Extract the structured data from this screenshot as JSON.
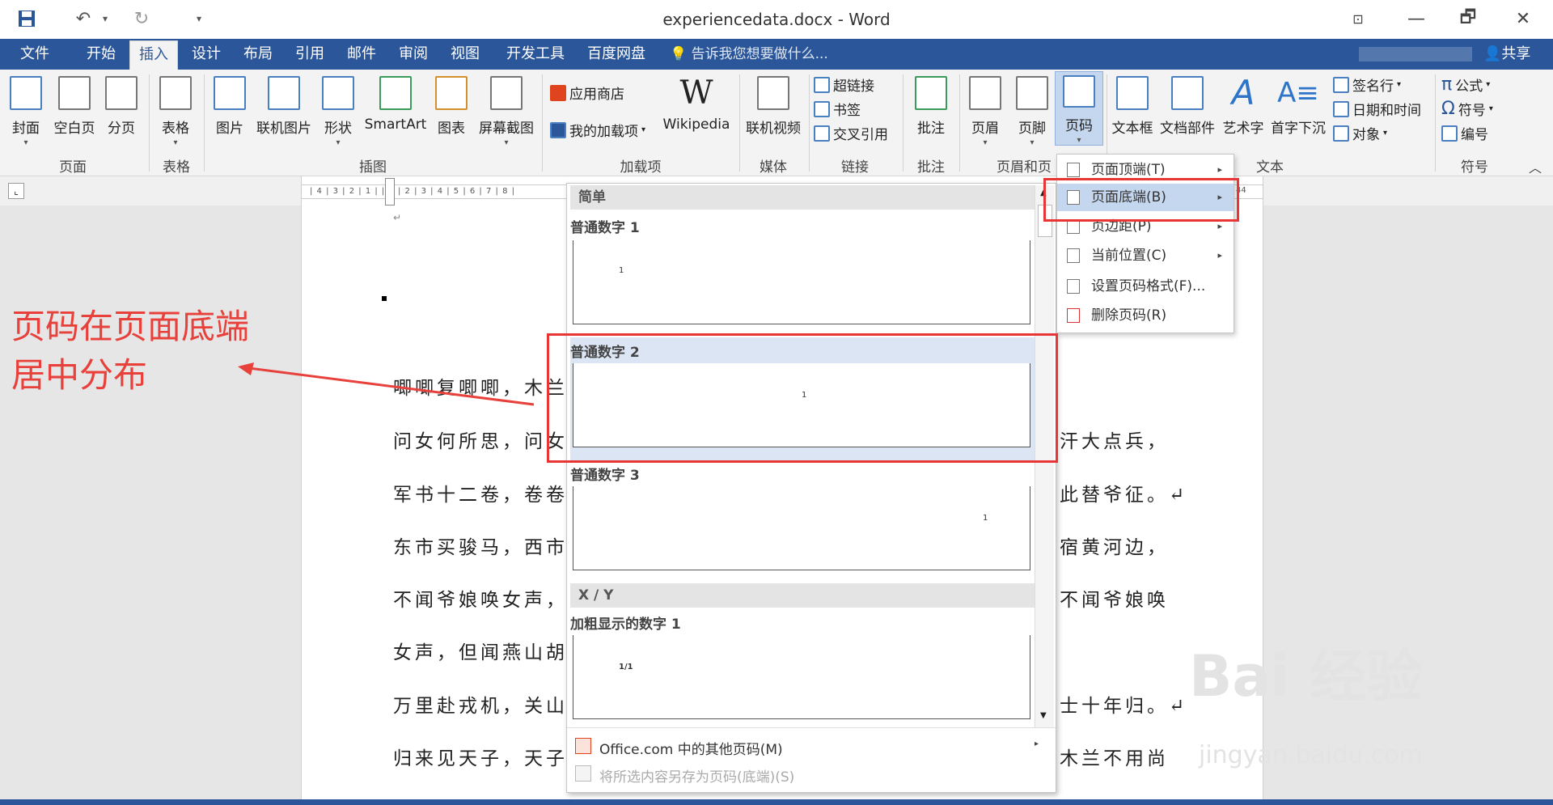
{
  "window": {
    "title": "experiencedata.docx - Word",
    "qat": {
      "save": "save-icon",
      "undo": "undo-icon",
      "redo": "redo-icon",
      "customize": "customize-qat-icon"
    },
    "controls": {
      "restore_ribbon": "ribbon-display-icon",
      "minimize": "—",
      "maximize": "🗗",
      "close": "✕"
    }
  },
  "tabs": {
    "file": "文件",
    "home": "开始",
    "insert": "插入",
    "design": "设计",
    "layout": "布局",
    "references": "引用",
    "mailings": "邮件",
    "review": "审阅",
    "view": "视图",
    "developer": "开发工具",
    "baidu": "百度网盘",
    "tellme": "告诉我您想要做什么...",
    "share": "共享"
  },
  "ribbon": {
    "pages": {
      "cover": "封面",
      "blank": "空白页",
      "break": "分页",
      "group": "页面"
    },
    "tables": {
      "table": "表格",
      "group": "表格"
    },
    "illustrations": {
      "pictures": "图片",
      "online_pictures": "联机图片",
      "shapes": "形状",
      "smartart": "SmartArt",
      "chart": "图表",
      "screenshot": "屏幕截图",
      "group": "插图"
    },
    "addins": {
      "store": "应用商店",
      "my_addins": "我的加载项",
      "wikipedia": "Wikipedia",
      "group": "加载项"
    },
    "media": {
      "online_video": "联机视频",
      "group": "媒体"
    },
    "links": {
      "hyperlink": "超链接",
      "bookmark": "书签",
      "cross_ref": "交叉引用",
      "group": "链接"
    },
    "comments": {
      "comment": "批注",
      "group": "批注"
    },
    "header_footer": {
      "header": "页眉",
      "footer": "页脚",
      "page_number": "页码",
      "group": "页眉和页"
    },
    "text": {
      "textbox": "文本框",
      "quick_parts": "文档部件",
      "wordart": "艺术字",
      "dropcap": "首字下沉",
      "signature": "签名行",
      "datetime": "日期和时间",
      "object": "对象",
      "group": "文本"
    },
    "symbols": {
      "equation": "公式",
      "symbol": "符号",
      "number": "编号",
      "group": "符号"
    }
  },
  "ruler": {
    "text": "| 4 | 3 | 2 | 1 |   | 1 | 2 | 3 | 4 | 5 | 6 | 7 | 8 |",
    "right_mark": "44"
  },
  "document": {
    "paragraph_mark": "↵",
    "lines_left": [
      "唧唧复唧唧，木兰",
      "问女何所思，问女",
      "军书十二卷，卷卷",
      "东市买骏马，西市",
      "不闻爷娘唤女声，",
      "女声，但闻燕山胡",
      "万里赴戎机，关山",
      "归来见天子，天子"
    ],
    "lines_right": [
      "汗大点兵，",
      "此替爷征。↵",
      "宿黄河边，",
      "不闻爷娘唤",
      "士十年归。↵",
      "木兰不用尚"
    ]
  },
  "annotation": {
    "text_line1": "页码在页面底端",
    "text_line2": "居中分布"
  },
  "gallery": {
    "section_simple": "简单",
    "items": [
      {
        "title": "普通数字 1",
        "number": "1"
      },
      {
        "title": "普通数字 2",
        "number": "1"
      },
      {
        "title": "普通数字 3",
        "number": "1"
      }
    ],
    "section_xy": "X / Y",
    "bold_item": {
      "title": "加粗显示的数字 1",
      "number": "1/1"
    },
    "footer": {
      "more": "Office.com 中的其他页码(M)",
      "save_selection": "将所选内容另存为页码(底端)(S)"
    }
  },
  "submenu": {
    "items": [
      {
        "label": "页面顶端(T)",
        "has_arrow": true
      },
      {
        "label": "页面底端(B)",
        "has_arrow": true
      },
      {
        "label": "页边距(P)",
        "has_arrow": true
      },
      {
        "label": "当前位置(C)",
        "has_arrow": true
      },
      {
        "label": "设置页码格式(F)...",
        "has_arrow": false
      },
      {
        "label": "删除页码(R)",
        "has_arrow": false
      }
    ]
  },
  "watermark": {
    "main": "Bai 经验",
    "sub": "jingyan.baidu.com"
  },
  "colors": {
    "accent": "#2b579a",
    "highlight": "#e83535",
    "annotation": "#e8413b"
  }
}
